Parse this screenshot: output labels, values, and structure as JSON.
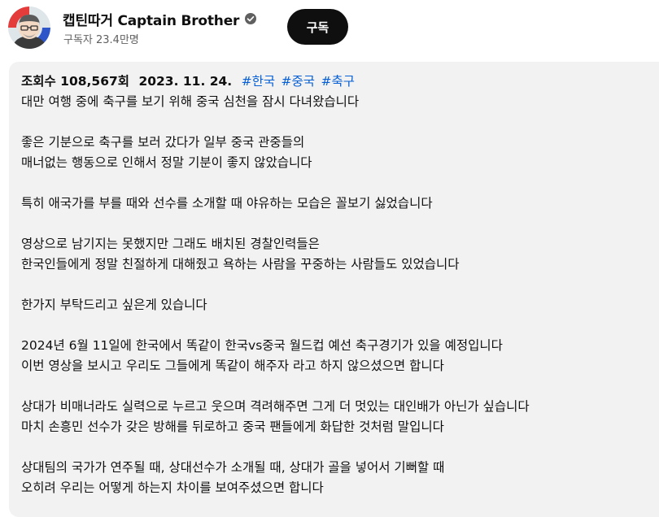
{
  "channel": {
    "name": "캡틴따거 Captain Brother",
    "subscribers": "구독자 23.4만명",
    "subscribe_label": "구독"
  },
  "description": {
    "views": "조회수 108,567회",
    "date": "2023. 11. 24.",
    "hashtags": [
      "#한국",
      "#중국",
      "#축구"
    ],
    "lines": [
      "대만 여행 중에 축구를 보기 위해 중국 심천을 잠시 다녀왔습니다",
      "",
      "좋은 기분으로 축구를 보러 갔다가 일부 중국 관중들의",
      "매너없는 행동으로 인해서 정말 기분이 좋지 않았습니다",
      "",
      "특히 애국가를 부를 때와 선수를 소개할 때 야유하는 모습은 꼴보기 싫었습니다",
      "",
      "영상으로 남기지는 못했지만 그래도 배치된 경찰인력들은",
      "한국인들에게 정말 친절하게 대해줬고 욕하는 사람을 꾸중하는 사람들도 있었습니다",
      "",
      "한가지 부탁드리고 싶은게 있습니다",
      "",
      "2024년 6월 11일에 한국에서 똑같이 한국vs중국 월드컵 예선 축구경기가 있을 예정입니다",
      "이번 영상을 보시고 우리도 그들에게 똑같이 해주자 라고 하지 않으셨으면 합니다",
      "",
      "상대가 비매너라도 실력으로 누르고 웃으며 격려해주면 그게 더 멋있는 대인배가 아닌가 싶습니다",
      "마치 손흥민 선수가 갖은 방해를 뒤로하고 중국 팬들에게 화답한 것처럼 말입니다",
      "",
      "상대팀의 국가가 연주될 때, 상대선수가 소개될 때, 상대가 골을 넣어서 기뻐할 때",
      "오히려 우리는 어떻게 하는지 차이를 보여주셨으면 합니다"
    ]
  }
}
